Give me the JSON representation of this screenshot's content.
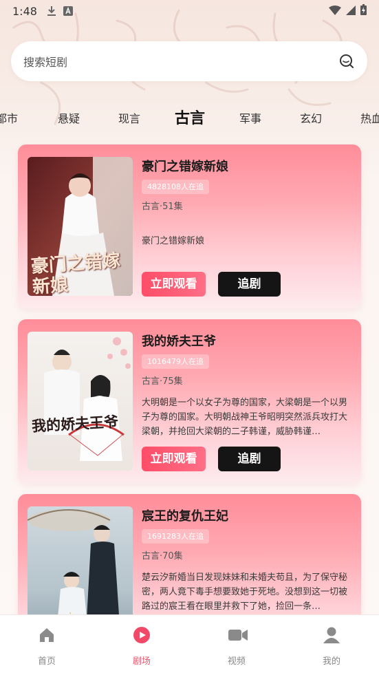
{
  "status_bar": {
    "time": "1:48",
    "icons": [
      "download-icon",
      "keyboard-a-icon",
      "wifi-icon",
      "signal-icon",
      "battery-charging-icon"
    ]
  },
  "search": {
    "placeholder": "搜索短剧",
    "icon": "search-icon"
  },
  "categories": {
    "tabs": [
      "都市",
      "悬疑",
      "现言",
      "古言",
      "军事",
      "玄幻",
      "热血"
    ],
    "active": "古言"
  },
  "dramas": [
    {
      "title": "豪门之错嫁新娘",
      "followers": "4828108人在追",
      "meta": "古言·51集",
      "description": "豪门之错嫁新娘",
      "cover_text": "豪门之错嫁新娘",
      "watch_label": "立即观看",
      "follow_label": "追剧"
    },
    {
      "title": "我的娇夫王爷",
      "followers": "1016479人在追",
      "meta": "古言·75集",
      "description": "大明朝是一个以女子为尊的国家，大梁朝是一个以男子为尊的国家。大明朝战神王爷昭明突然派兵攻打大梁朝，并抢回大梁朝的二子韩谨，威胁韩谨…",
      "cover_text": "我的娇夫王爷",
      "watch_label": "立即观看",
      "follow_label": "追剧"
    },
    {
      "title": "宸王的复仇王妃",
      "followers": "1691283人在追",
      "meta": "古言·70集",
      "description": "楚云汐新婚当日发现妹妹和未婚夫苟且，为了保守秘密，两人竟下毒手想要致她于死地。没想到这一切被路过的宸王看在眼里并救下了她，捡回一条…",
      "cover_text": "",
      "watch_label": "立即观看",
      "follow_label": "追剧"
    }
  ],
  "bottom_nav": {
    "items": [
      {
        "label": "首页",
        "icon": "home-icon"
      },
      {
        "label": "剧场",
        "icon": "theater-play-icon"
      },
      {
        "label": "视频",
        "icon": "video-camera-icon"
      },
      {
        "label": "我的",
        "icon": "user-icon"
      }
    ],
    "active": "剧场"
  },
  "colors": {
    "accent": "#e9546b",
    "card_top": "#ff8d99",
    "follow_button": "#151515"
  }
}
